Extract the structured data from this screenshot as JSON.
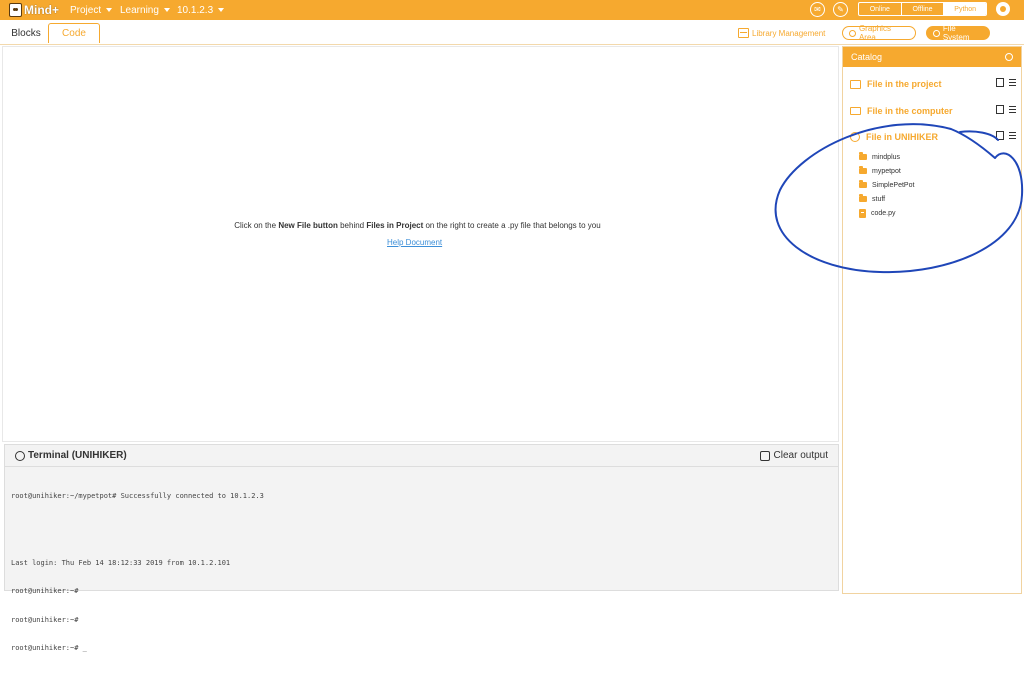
{
  "app": {
    "logo_text": "Mind+",
    "menus": [
      {
        "label": "Project"
      },
      {
        "label": "Learning"
      },
      {
        "label": "10.1.2.3"
      }
    ],
    "modes": [
      "Online",
      "Offline",
      "Python"
    ]
  },
  "tabs": {
    "blocks": "Blocks",
    "code": "Code"
  },
  "toolbar": {
    "library_management": "Library Management",
    "graphics_area": "Graphics Area",
    "file_system": "File System"
  },
  "editor": {
    "hint_prefix": "Click on the ",
    "hint_bold_1": "New File button",
    "hint_middle": " behind ",
    "hint_bold_2": "Files in Project",
    "hint_suffix": " on the right to create a .py file that belongs to you",
    "help_link": "Help Document"
  },
  "terminal": {
    "title": "Terminal (UNIHIKER)",
    "clear_label": "Clear output",
    "lines": [
      "root@unihiker:~/mypetpot# Successfully connected to 10.1.2.3",
      "",
      "",
      "Last login: Thu Feb 14 18:12:33 2019 from 10.1.2.101",
      "root@unihiker:~#",
      "root@unihiker:~#",
      "root@unihiker:~# _"
    ]
  },
  "catalog": {
    "title": "Catalog",
    "sections": [
      {
        "label": "File in the project"
      },
      {
        "label": "File in the computer"
      },
      {
        "label": "File in UNIHIKER"
      }
    ],
    "unihiker_files": [
      {
        "name": "mindplus",
        "type": "folder"
      },
      {
        "name": "mypetpot",
        "type": "folder"
      },
      {
        "name": "SimplePetPot",
        "type": "folder"
      },
      {
        "name": "stuff",
        "type": "folder"
      },
      {
        "name": "code.py",
        "type": "file"
      }
    ]
  },
  "colors": {
    "accent": "#f6a92f",
    "link": "#3d8fd8",
    "annotation": "#1f46b8"
  }
}
